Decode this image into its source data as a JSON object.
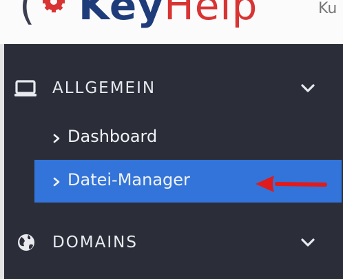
{
  "header": {
    "logo": {
      "paren": "(",
      "key": "Key",
      "help": "Help"
    },
    "user_text": "Ku"
  },
  "sidebar": {
    "sections": [
      {
        "label": "ALLGEMEIN",
        "icon": "monitor-icon",
        "expanded": true,
        "items": [
          {
            "label": "Dashboard",
            "active": false
          },
          {
            "label": "Datei-Manager",
            "active": true
          }
        ]
      },
      {
        "label": "DOMAINS",
        "icon": "globe-icon",
        "expanded": false,
        "items": []
      }
    ]
  },
  "colors": {
    "sidebar_bg": "#2b2e38",
    "active_bg": "#3274d9",
    "logo_blue": "#1f3c7a",
    "logo_red": "#d83434",
    "annotation_arrow": "#e11b1b"
  }
}
